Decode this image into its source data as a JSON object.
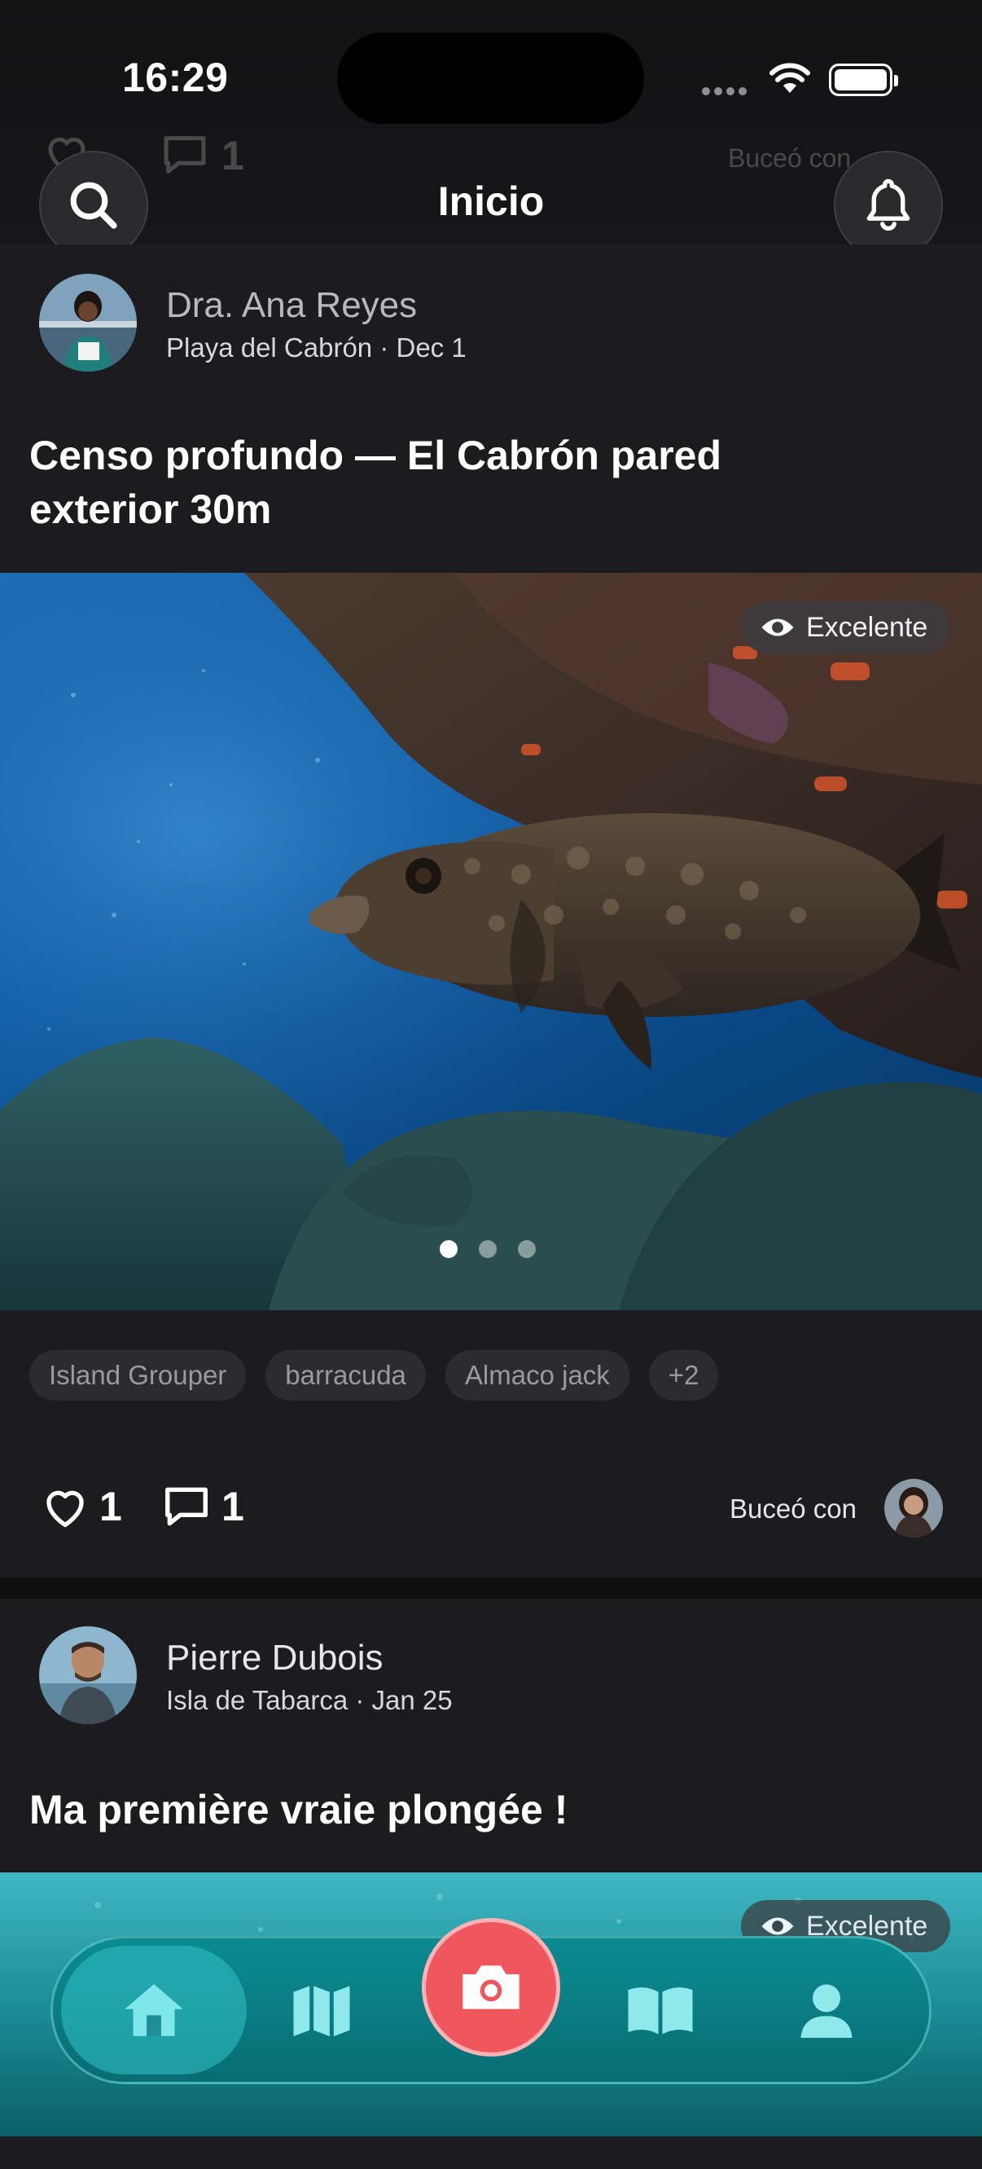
{
  "status_bar": {
    "time": "16:29"
  },
  "header": {
    "title": "Inicio",
    "search_icon": "search-icon",
    "notifications_icon": "bell-icon"
  },
  "posts": [
    {
      "author": "Dra. Ana Reyes",
      "location_date": "Playa del Cabrón · Dec 1",
      "title": "Censo profundo — El Cabrón pared exterior 30m",
      "visibility": "Excelente",
      "carousel_index": 1,
      "carousel_total": 3,
      "species": [
        "Island Grouper",
        "barracuda",
        "Almaco jack",
        "+2"
      ],
      "likes": "1",
      "comments": "1",
      "dived_with_label": "Buceó con"
    },
    {
      "author": "Pierre Dubois",
      "location_date": "Isla de Tabarca · Jan 25",
      "title": "Ma première vraie plongée !",
      "visibility": "Excelente"
    }
  ],
  "ghost_header": {
    "likes": "1",
    "comments": "1",
    "dived_with_label": "Buceó con"
  },
  "bottom_nav": {
    "items": [
      "home-icon",
      "map-icon",
      "camera-icon",
      "book-icon",
      "profile-icon"
    ],
    "active": "home",
    "accent": "#0b8c92",
    "camera_color": "#f0565d"
  }
}
